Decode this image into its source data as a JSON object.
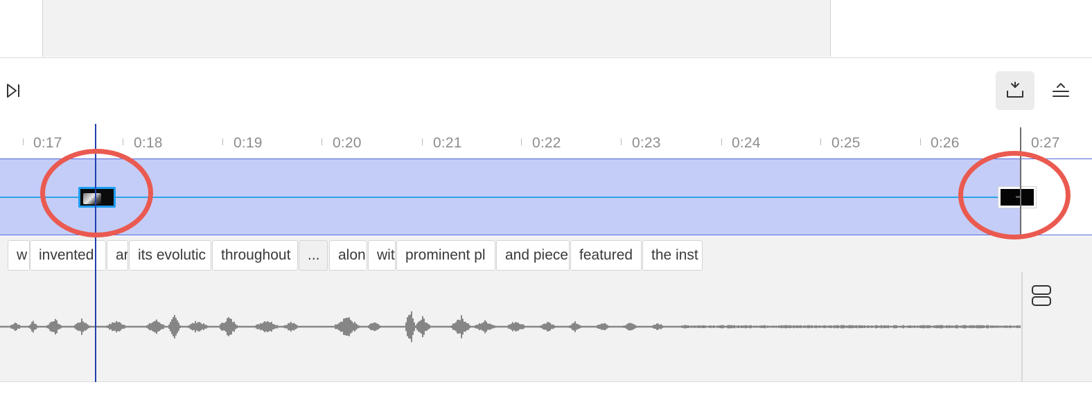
{
  "toolbar": {
    "skip_end_icon": "skip-to-end-icon",
    "collapse_icon": "collapse-track-icon",
    "expand_icon": "expand-track-icon"
  },
  "ruler": {
    "labels": [
      "0:17",
      "0:18",
      "0:19",
      "0:20",
      "0:21",
      "0:22",
      "0:23",
      "0:24",
      "0:25",
      "0:26",
      "0:27"
    ]
  },
  "transcript": {
    "words": [
      "w",
      "invented",
      "ar",
      "its evolutic",
      "throughout",
      "...",
      "alon",
      "wit",
      "prominent pl",
      "and piece",
      "featured",
      "the inst"
    ]
  },
  "audio": {
    "split_icon": "split-view-icon"
  },
  "colors": {
    "video_track": "#c4cdf7",
    "playhead": "#1f3fae",
    "selection_border": "#1e9df2",
    "annotation": "#ea5a50"
  }
}
